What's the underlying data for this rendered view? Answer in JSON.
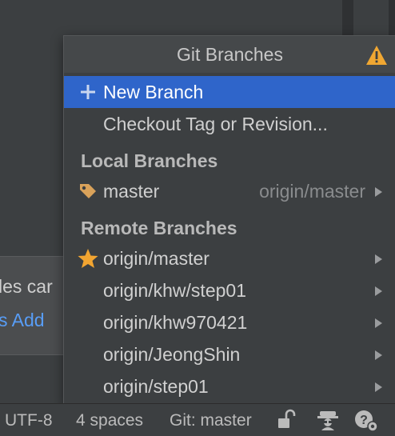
{
  "background": {
    "notification_line1": "les car",
    "notification_link": "s Add"
  },
  "popup": {
    "title": "Git Branches",
    "warning_icon": "warning-triangle-icon",
    "actions": [
      {
        "label": "New Branch",
        "icon": "plus-icon",
        "selected": true
      },
      {
        "label": "Checkout Tag or Revision...",
        "selected": false
      }
    ],
    "local_header": "Local Branches",
    "local_branches": [
      {
        "name": "master",
        "tracking": "origin/master",
        "icon": "tag-icon"
      }
    ],
    "remote_header": "Remote Branches",
    "remote_branches": [
      {
        "name": "origin/master",
        "icon": "star-icon"
      },
      {
        "name": "origin/khw/step01"
      },
      {
        "name": "origin/khw970421"
      },
      {
        "name": "origin/JeongShin"
      },
      {
        "name": "origin/step01"
      }
    ]
  },
  "statusbar": {
    "encoding": "UTF-8",
    "indent": "4 spaces",
    "git_branch": "Git: master"
  },
  "colors": {
    "selection": "#2f65ca",
    "warning": "#f0a732",
    "star": "#f2a531",
    "tag": "#d9a25a",
    "link": "#589df6"
  }
}
